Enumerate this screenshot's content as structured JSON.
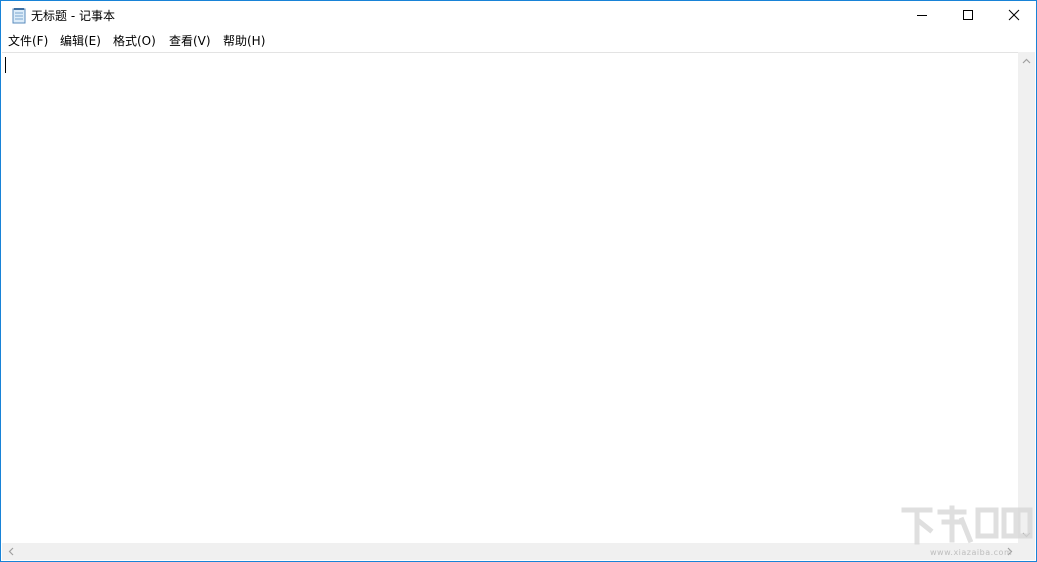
{
  "window": {
    "title": "无标题 - 记事本",
    "accent_color": "#1883d7",
    "icons": [
      "notepad-icon",
      "minimize-icon",
      "maximize-icon",
      "close-icon"
    ]
  },
  "menu": {
    "items": [
      {
        "label": "文件(F)"
      },
      {
        "label": "编辑(E)"
      },
      {
        "label": "格式(O)"
      },
      {
        "label": "查看(V)"
      },
      {
        "label": "帮助(H)"
      }
    ]
  },
  "editor": {
    "content": ""
  },
  "watermark": {
    "site": "www.xiazaiba.com"
  }
}
